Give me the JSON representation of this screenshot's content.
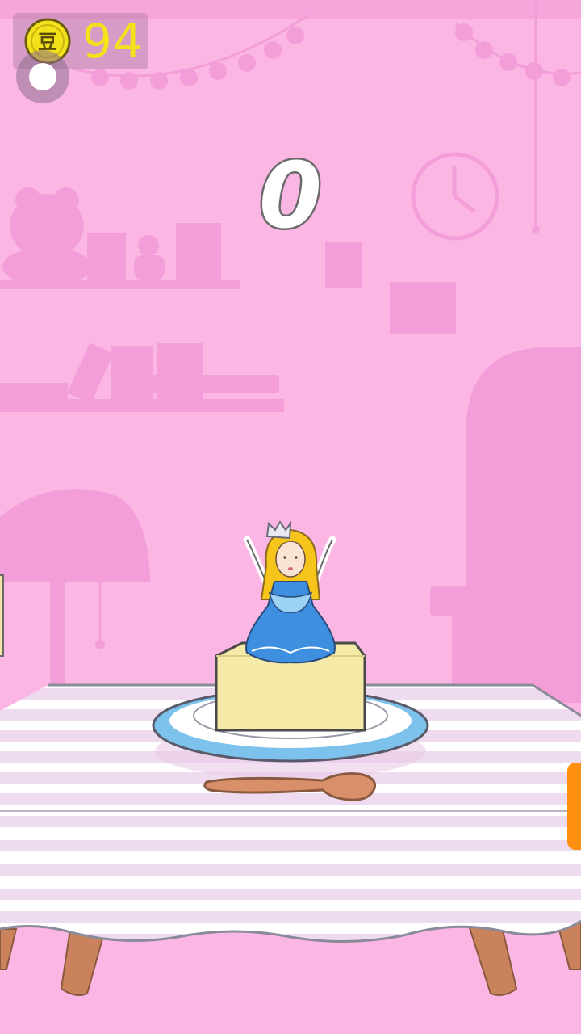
{
  "hud": {
    "coin_icon": "bean-coin-icon",
    "coin_glyph": "豆",
    "coin_count": "94",
    "pause_icon": "pause-dot-icon"
  },
  "game": {
    "score": "0"
  },
  "side_tab": {
    "color": "#ff8f0f"
  },
  "colors": {
    "background": "#fbb6e4",
    "silhouette": "#f39ed8",
    "tablecloth_stripe": "#eedbf0",
    "coin": "#f3e21b"
  }
}
